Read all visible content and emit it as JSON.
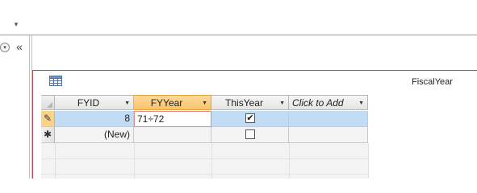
{
  "toolbar": {
    "quick_access_glyph": "▾"
  },
  "nav": {
    "expand_glyph": "▾",
    "collapse_glyph": "«"
  },
  "tab": {
    "title": "FiscalYear"
  },
  "columns": [
    {
      "label": "FYID"
    },
    {
      "label": "FYYear"
    },
    {
      "label": "ThisYear"
    },
    {
      "label": "Click to Add"
    }
  ],
  "dropdown_glyph": "▼",
  "rows": [
    {
      "selector": "✎",
      "fyid": "8",
      "fyyear": "71÷72",
      "thisyear": "checked"
    },
    {
      "selector": "✱",
      "fyid": "(New)",
      "fyyear": "",
      "thisyear": "unchecked"
    }
  ],
  "checkmark": "✔",
  "colors": {
    "accent_red": "#b3494c",
    "selected_row": "#c3dcf5",
    "active_header": "#f9c46a"
  }
}
